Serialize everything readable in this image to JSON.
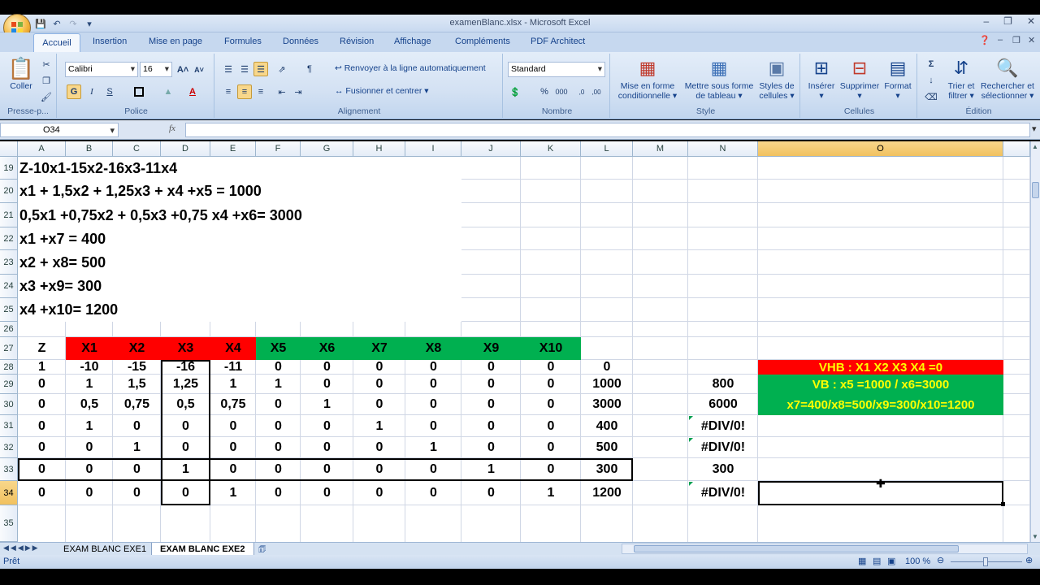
{
  "window": {
    "title": "examenBlanc.xlsx - Microsoft Excel"
  },
  "tabs": [
    "Accueil",
    "Insertion",
    "Mise en page",
    "Formules",
    "Données",
    "Révision",
    "Affichage",
    "Compléments",
    "PDF Architect"
  ],
  "ribbon": {
    "clipboard": {
      "paste": "Coller",
      "label": "Presse-p..."
    },
    "font": {
      "name": "Calibri",
      "size": "16",
      "label": "Police",
      "bold": "G",
      "italic": "I",
      "underline": "S"
    },
    "alignment": {
      "wrap": "Renvoyer à la ligne automatiquement",
      "merge": "Fusionner et centrer",
      "label": "Alignement"
    },
    "number": {
      "format": "Standard",
      "label": "Nombre",
      "percent": "%",
      "thousands": "000"
    },
    "style": {
      "cond1": "Mise en forme",
      "cond2": "conditionnelle",
      "table1": "Mettre sous forme",
      "table2": "de tableau",
      "cells1": "Styles de",
      "cells2": "cellules",
      "label": "Style"
    },
    "cells": {
      "insert": "Insérer",
      "delete": "Supprimer",
      "format": "Format",
      "label": "Cellules"
    },
    "editing": {
      "sort1": "Trier et",
      "sort2": "filtrer",
      "find1": "Rechercher et",
      "find2": "sélectionner",
      "label": "Édition",
      "sigma": "Σ"
    }
  },
  "formula_bar": {
    "name_box": "O34",
    "fx": "fx",
    "content": ""
  },
  "columns": [
    "A",
    "B",
    "C",
    "D",
    "E",
    "F",
    "G",
    "H",
    "I",
    "J",
    "K",
    "L",
    "M",
    "N",
    "O"
  ],
  "rows": [
    "19",
    "20",
    "21",
    "22",
    "23",
    "24",
    "25",
    "26",
    "27",
    "28",
    "29",
    "30",
    "31",
    "32",
    "33",
    "34",
    "35"
  ],
  "text_rows": {
    "r19": "Z-10x1-15x2-16x3-11x4",
    "r20": "x1 + 1,5x2 + 1,25x3 + x4 +x5 = 1000",
    "r21": "0,5x1 +0,75x2 + 0,5x3 +0,75 x4  +x6= 3000",
    "r22": "x1  +x7 = 400",
    "r23": "x2  + x8= 500",
    "r24": "x3  +x9= 300",
    "r25": "x4  +x10= 1200"
  },
  "table_header": [
    "Z",
    "X1",
    "X2",
    "X3",
    "X4",
    "X5",
    "X6",
    "X7",
    "X8",
    "X9",
    "X10"
  ],
  "table": [
    [
      "1",
      "-10",
      "-15",
      "-16",
      "-11",
      "0",
      "0",
      "0",
      "0",
      "0",
      "0",
      "0"
    ],
    [
      "0",
      "1",
      "1,5",
      "1,25",
      "1",
      "1",
      "0",
      "0",
      "0",
      "0",
      "0",
      "1000"
    ],
    [
      "0",
      "0,5",
      "0,75",
      "0,5",
      "0,75",
      "0",
      "1",
      "0",
      "0",
      "0",
      "0",
      "3000"
    ],
    [
      "0",
      "1",
      "0",
      "0",
      "0",
      "0",
      "0",
      "1",
      "0",
      "0",
      "0",
      "400"
    ],
    [
      "0",
      "0",
      "1",
      "0",
      "0",
      "0",
      "0",
      "0",
      "1",
      "0",
      "0",
      "500"
    ],
    [
      "0",
      "0",
      "0",
      "1",
      "0",
      "0",
      "0",
      "0",
      "0",
      "1",
      "0",
      "300"
    ],
    [
      "0",
      "0",
      "0",
      "0",
      "1",
      "0",
      "0",
      "0",
      "0",
      "0",
      "1",
      "1200"
    ]
  ],
  "ratios": [
    "",
    "800",
    "6000",
    "#DIV/0!",
    "#DIV/0!",
    "300",
    "#DIV/0!"
  ],
  "notes": {
    "vhb": "VHB : X1 X2 X3 X4 =0",
    "vb": "VB : x5 =1000 / x6=3000",
    "vb2": "x7=400/x8=500/x9=300/x10=1200"
  },
  "sheet_tabs": [
    "EXAM BLANC EXE1",
    "EXAM BLANC EXE2"
  ],
  "status": {
    "text": "Prêt",
    "zoom": "100 %"
  },
  "colors": {
    "red": "#ff0000",
    "green": "#00b050",
    "selected_header": "#f1c15f"
  }
}
